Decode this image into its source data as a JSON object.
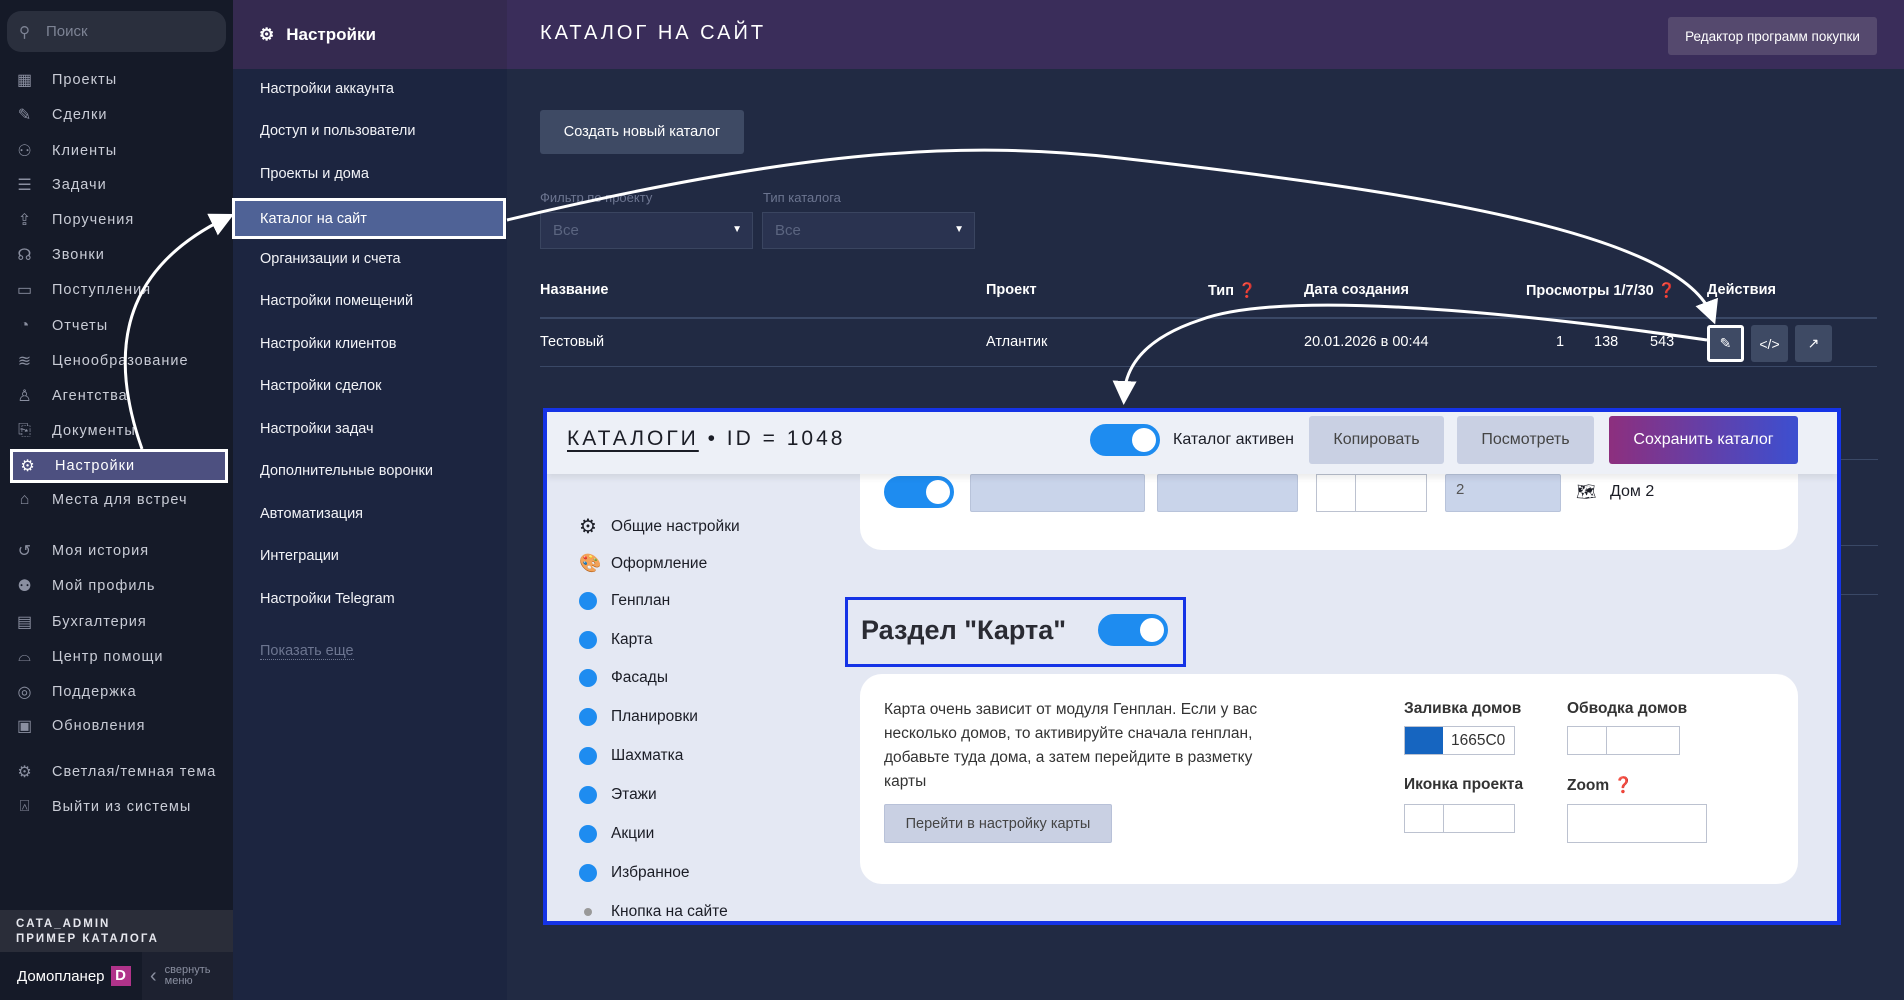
{
  "sidebar": {
    "search_placeholder": "Поиск",
    "items": [
      "Проекты",
      "Сделки",
      "Клиенты",
      "Задачи",
      "Поручения",
      "Звонки",
      "Поступления",
      "Отчеты",
      "Ценообразование",
      "Агентства",
      "Документы",
      "Настройки",
      "Места для встреч",
      "Моя история",
      "Мой профиль",
      "Бухгалтерия",
      "Центр помощи",
      "Поддержка",
      "Обновления",
      "Светлая/темная тема",
      "Выйти из системы"
    ],
    "user": "CATA_ADMIN",
    "account": "ПРИМЕР КАТАЛОГА",
    "brand": "Домопланер",
    "brand_logo": "D",
    "collapse_line1": "свернуть",
    "collapse_line2": "меню"
  },
  "settings": {
    "title": "Настройки",
    "items": [
      "Настройки аккаунта",
      "Доступ и пользователи",
      "Проекты и дома",
      "Каталог на сайт",
      "Организации и счета",
      "Настройки помещений",
      "Настройки клиентов",
      "Настройки сделок",
      "Настройки задач",
      "Дополнительные воронки",
      "Автоматизация",
      "Интеграции",
      "Настройки Telegram"
    ],
    "show_more": "Показать еще"
  },
  "main": {
    "title": "КАТАЛОГ НА САЙТ",
    "editor_button": "Редактор программ покупки",
    "create_button": "Создать новый каталог",
    "filter_project_label": "Фильтр по проекту",
    "filter_project_value": "Все",
    "filter_type_label": "Тип каталога",
    "filter_type_value": "Все",
    "columns": [
      "Название",
      "Проект",
      "Тип",
      "Дата создания",
      "Просмотры 1/7/30",
      "Действия"
    ],
    "row": {
      "name": "Тестовый",
      "project": "Атлантик",
      "date": "20.01.2026 в 00:44",
      "views_1": "1",
      "views_7": "138",
      "views_30": "543"
    }
  },
  "overlay": {
    "title_part": "КАТАЛОГИ",
    "title_id": "• ID = 1048",
    "active_label": "Каталог активен",
    "copy": "Копировать",
    "view": "Посмотреть",
    "save": "Сохранить каталог",
    "row_value": "2",
    "row_house": "Дом 2",
    "nav": [
      "Общие настройки",
      "Оформление",
      "Генплан",
      "Карта",
      "Фасады",
      "Планировки",
      "Шахматка",
      "Этажи",
      "Акции",
      "Избранное",
      "Кнопка на сайте"
    ],
    "section_title": "Раздел \"Карта\"",
    "description": "Карта очень зависит от модуля Генплан. Если у вас несколько домов, то активируйте сначала генплан, добавьте туда дома, а затем перейдите в разметку карты",
    "map_settings_button": "Перейти в настройку карты",
    "fill_label": "Заливка домов",
    "fill_value": "1665C0",
    "fill_color": "#1665C0",
    "stroke_label": "Обводка домов",
    "icon_label": "Иконка проекта",
    "zoom_label": "Zoom"
  }
}
